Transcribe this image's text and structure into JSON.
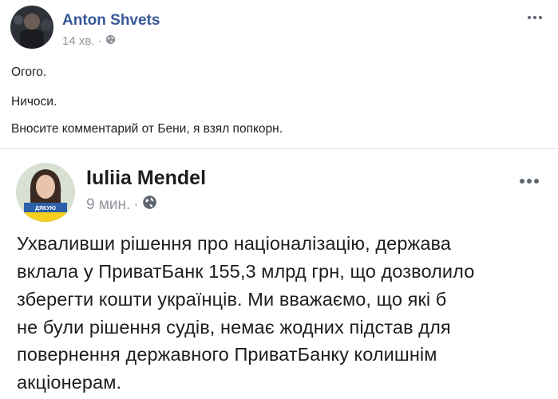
{
  "outer_post": {
    "author": "Anton Shvets",
    "time": "14 хв.",
    "separator": "·",
    "privacy_icon": "globe-icon",
    "more_icon": "more-options-icon",
    "lines": [
      "Огого.",
      "Ничоси.",
      "Вносите комментарий от Бени, я взял попкорн."
    ]
  },
  "shared_post": {
    "author": "Iuliia Mendel",
    "time": "9 мин.",
    "separator": "·",
    "privacy_icon": "globe-icon",
    "more_icon": "more-options-icon",
    "avatar_badge_text": "ДЯКУЮ",
    "lines": [
      "Ухваливши рішення про націоналізацію, держава",
      "вклала у ПриватБанк 155,3 млрд грн, що дозволило",
      "зберегти кошти українців. Ми вважаємо, що які б",
      "не були рішення судів, немає жодних підстав для",
      "повернення державного ПриватБанку колишнім",
      "акціонерам."
    ]
  },
  "colors": {
    "link_blue": "#365899",
    "meta_gray": "#90949c",
    "text": "#1c1e21",
    "divider": "#dddfe2"
  }
}
